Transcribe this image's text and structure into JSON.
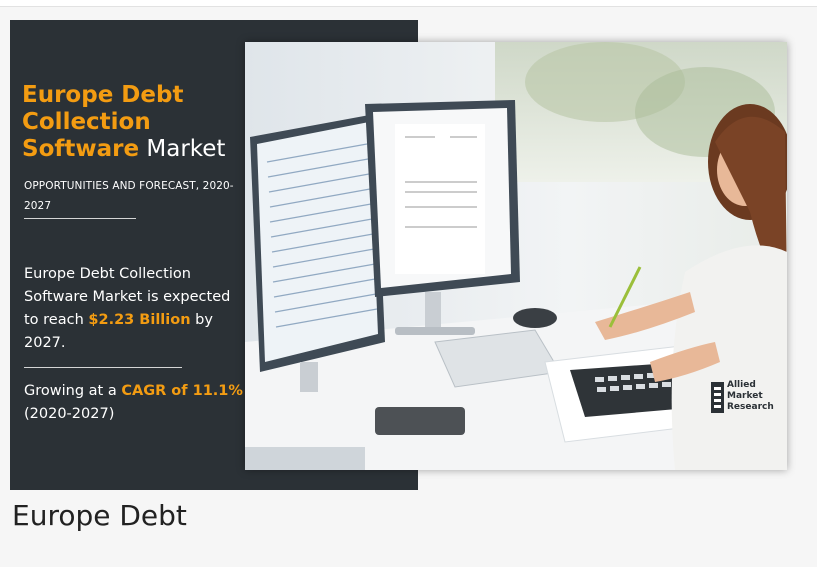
{
  "banner": {
    "title_highlight": "Europe Debt Collection Software",
    "title_plain": " Market",
    "subtitle": "OPPORTUNITIES AND FORECAST, 2020-2027",
    "body_prefix": "Europe Debt Collection Software Market is expected to reach ",
    "body_value": "$2.23 Billion",
    "body_suffix": " by 2027.",
    "growth_prefix": "Growing at a ",
    "growth_value": "CAGR of 11.1%",
    "growth_suffix": " (2020-2027)",
    "logo_lines": [
      "Allied",
      "Market",
      "Research"
    ]
  },
  "caption": "Europe Debt",
  "colors": {
    "accent": "#f39c12",
    "panel": "#2b3136",
    "page": "#f6f6f6"
  }
}
